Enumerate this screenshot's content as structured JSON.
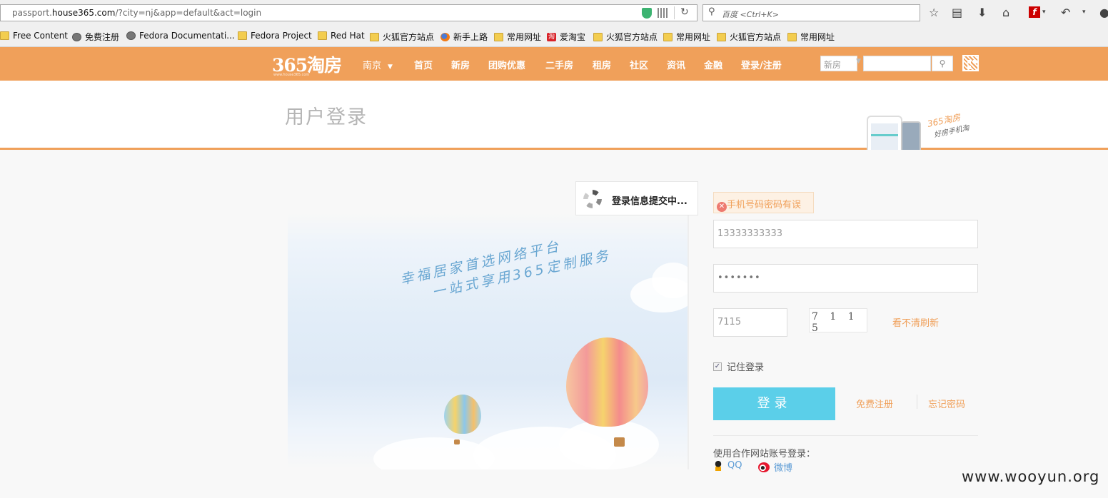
{
  "browser": {
    "url_prefix": "passport.",
    "url_domain": "house365.com",
    "url_path": "/?city=nj&app=default&act=login",
    "search_placeholder": "百度 <Ctrl+K>",
    "flash_label": "f"
  },
  "bookmarks": [
    {
      "label": "Free Content",
      "icon": "folder"
    },
    {
      "label": "免费注册",
      "icon": "globe"
    },
    {
      "label": "Fedora Documentati...",
      "icon": "globe"
    },
    {
      "label": "Fedora Project",
      "icon": "folder"
    },
    {
      "label": "Red Hat",
      "icon": "folder"
    },
    {
      "label": "火狐官方站点",
      "icon": "folder"
    },
    {
      "label": "新手上路",
      "icon": "firefox"
    },
    {
      "label": "常用网址",
      "icon": "folder"
    },
    {
      "label": "爱淘宝",
      "icon": "taobao",
      "icon_text": "淘"
    },
    {
      "label": "火狐官方站点",
      "icon": "folder"
    },
    {
      "label": "常用网址",
      "icon": "folder"
    },
    {
      "label": "火狐官方站点",
      "icon": "folder"
    },
    {
      "label": "常用网址",
      "icon": "folder"
    }
  ],
  "site": {
    "logo": "365淘房",
    "logo_sub": "www.house365.com",
    "city": "南京",
    "nav": [
      "首页",
      "新房",
      "团购优惠",
      "二手房",
      "租房",
      "社区",
      "资讯",
      "金融",
      "登录/注册"
    ],
    "search_type": "新房",
    "accent": "#f0a05a"
  },
  "title_band": {
    "page_title": "用户登录",
    "brand_tag_1": "365淘房",
    "brand_tag_2": "好房手机淘"
  },
  "illustration": {
    "slogan_1": "幸福居家首选网络平台",
    "slogan_2": "一站式享用365定制服务"
  },
  "loading": {
    "text": "登录信息提交中..."
  },
  "form": {
    "error": "手机号码密码有误",
    "phone": "13333333333",
    "password_mask": "•••••••",
    "captcha_value": "7115",
    "captcha_image": "7 1 1 5",
    "refresh": "看不清刷新",
    "remember": "记住登录",
    "login": "登录",
    "register": "免费注册",
    "forgot": "忘记密码",
    "partner_label": "使用合作网站账号登录：",
    "qq": "QQ",
    "weibo": "微博",
    "button_color": "#5bcfe9"
  },
  "watermark": "www.wooyun.org"
}
